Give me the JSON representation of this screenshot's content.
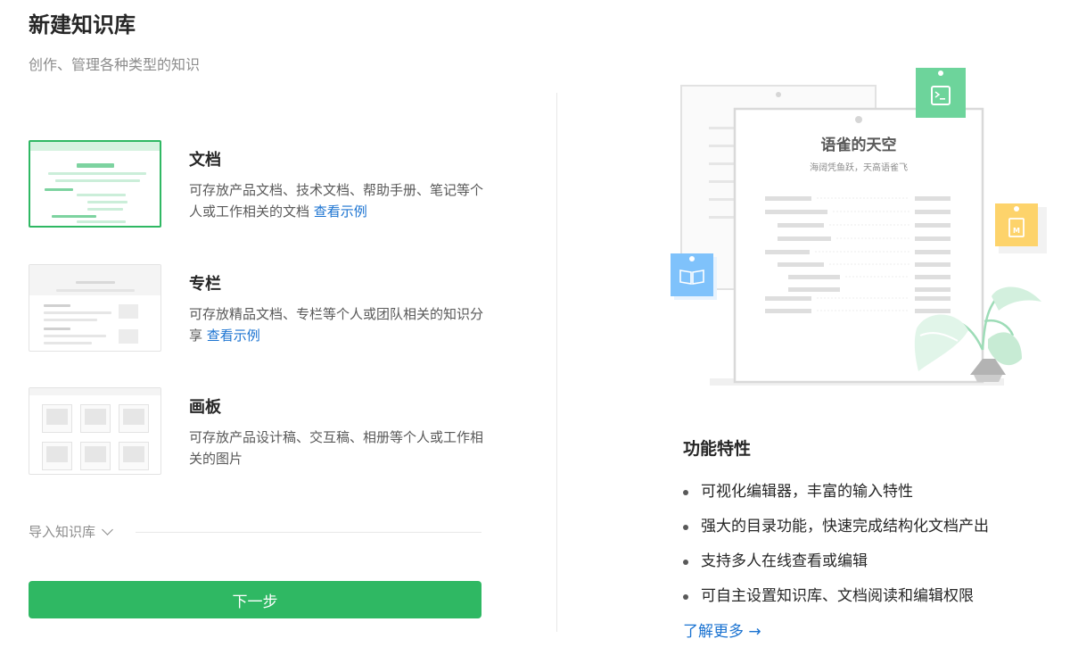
{
  "header": {
    "title": "新建知识库",
    "subtitle": "创作、管理各种类型的知识"
  },
  "types": [
    {
      "title": "文档",
      "desc": "可存放产品文档、技术文档、帮助手册、笔记等个人或工作相关的文档",
      "link": "查看示例",
      "selected": true
    },
    {
      "title": "专栏",
      "desc": "可存放精品文档、专栏等个人或团队相关的知识分享",
      "link": "查看示例",
      "selected": false
    },
    {
      "title": "画板",
      "desc": "可存放产品设计稿、交互稿、相册等个人或工作相关的图片",
      "link": "",
      "selected": false
    }
  ],
  "import": {
    "label": "导入知识库"
  },
  "next_button": {
    "label": "下一步"
  },
  "illustration": {
    "doc_title": "语雀的天空",
    "doc_subtitle": "海阔凭鱼跃，天高语雀飞",
    "badge_colors": {
      "terminal": "#6dd49b",
      "markdown": "#fdd36b",
      "book": "#7fc2fb"
    }
  },
  "features": {
    "title": "功能特性",
    "items": [
      "可视化编辑器，丰富的输入特性",
      "强大的目录功能，快速完成结构化文档产出",
      "支持多人在线查看或编辑",
      "可自主设置知识库、文档阅读和编辑权限"
    ],
    "learn_more": "了解更多"
  },
  "colors": {
    "accent": "#2fb863",
    "link": "#1b73d1"
  }
}
